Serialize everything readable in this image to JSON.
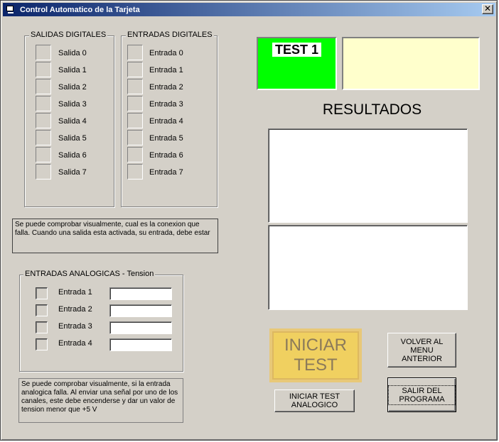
{
  "window": {
    "title": "Control Automatico de la Tarjeta",
    "close_glyph": "✕"
  },
  "digital_outputs": {
    "title": "SALIDAS DIGITALES",
    "items": [
      "Salida 0",
      "Salida 1",
      "Salida 2",
      "Salida 3",
      "Salida 4",
      "Salida 5",
      "Salida 6",
      "Salida 7"
    ]
  },
  "digital_inputs": {
    "title": "ENTRADAS DIGITALES",
    "items": [
      "Entrada 0",
      "Entrada 1",
      "Entrada 2",
      "Entrada 3",
      "Entrada 4",
      "Entrada 5",
      "Entrada 6",
      "Entrada 7"
    ]
  },
  "digital_note": "Se puede comprobar visualmente, cual es la conexion que falla. Cuando una salida esta activada, su entrada, debe estar",
  "analog_inputs": {
    "title": "ENTRADAS ANALOGICAS - Tension",
    "items": [
      {
        "label": "Entrada 1",
        "value": ""
      },
      {
        "label": "Entrada 2",
        "value": ""
      },
      {
        "label": "Entrada 3",
        "value": ""
      },
      {
        "label": "Entrada 4",
        "value": ""
      }
    ]
  },
  "analog_note": "Se puede comprobar visualmente, si la entrada analogica falla. Al enviar una señal por uno de los canales, este debe encenderse y dar un valor de tension menor que +5 V",
  "test_status": {
    "label": "TEST 1",
    "color": "#00ff00",
    "message_color": "#ffffcc"
  },
  "results": {
    "title": "RESULTADOS"
  },
  "buttons": {
    "start_test": "INICIAR TEST",
    "start_analog_test": "INICIAR TEST ANALOGICO",
    "back": "VOLVER AL MENU ANTERIOR",
    "exit": "SALIR DEL PROGRAMA"
  },
  "icons": {
    "app": "computer-icon",
    "close": "close-icon"
  }
}
